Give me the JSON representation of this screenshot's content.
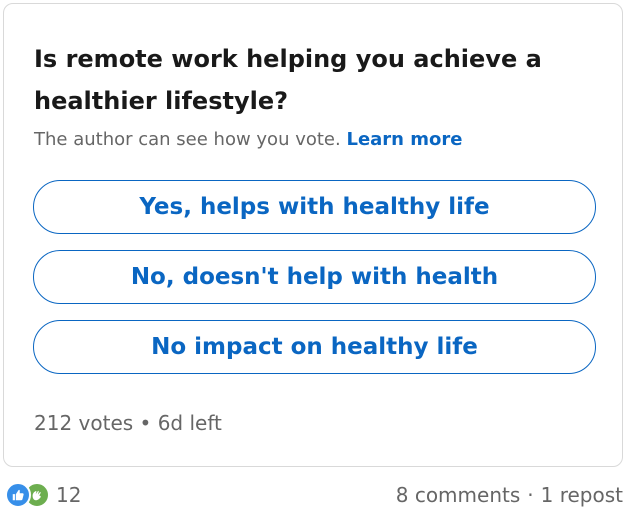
{
  "poll": {
    "question": "Is remote work helping you achieve a healthier lifestyle?",
    "visibility_note": "The author can see how you vote.",
    "learn_more": "Learn more",
    "options": [
      {
        "label": "Yes, helps with healthy life"
      },
      {
        "label": "No, doesn't help with health"
      },
      {
        "label": "No impact on healthy life"
      }
    ],
    "votes": "212 votes",
    "separator": "•",
    "time_left": "6d left"
  },
  "social": {
    "reaction_icons": [
      "like-icon",
      "celebrate-icon"
    ],
    "reaction_count": "12",
    "comments": "8 comments",
    "separator": "·",
    "reposts": "1 repost"
  },
  "colors": {
    "accent": "#0a66c2",
    "muted_text": "#666666",
    "like": "#378fe9",
    "celebrate": "#6dae4f"
  }
}
